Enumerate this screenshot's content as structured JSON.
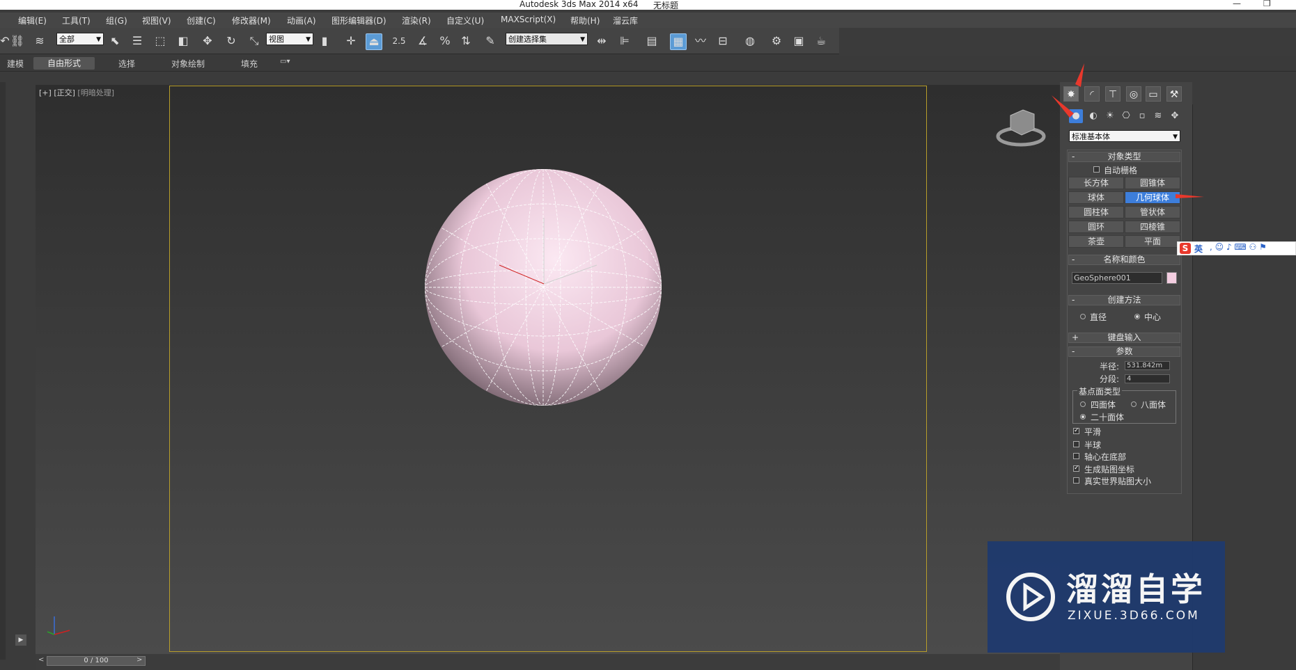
{
  "title": {
    "app": "Autodesk 3ds Max  2014 x64",
    "doc": "无标题"
  },
  "menu": [
    "编辑(E)",
    "工具(T)",
    "组(G)",
    "视图(V)",
    "创建(C)",
    "修改器(M)",
    "动画(A)",
    "图形编辑器(D)",
    "渲染(R)",
    "自定义(U)",
    "MAXScript(X)",
    "帮助(H)",
    "溜云库"
  ],
  "toolbar": {
    "filter_select": "全部",
    "coord_select": "视图",
    "snap_value": "2.5",
    "named_selection": "创建选择集"
  },
  "ribbon_tabs": [
    "建模",
    "自由形式",
    "选择",
    "对象绘制",
    "填充"
  ],
  "viewport": {
    "label_plus": "[+]",
    "label_view": "[正交]",
    "label_shading": "[明暗处理]"
  },
  "command_panel": {
    "category_select": "标准基本体",
    "object_type": {
      "title": "对象类型",
      "autogrid": "自动栅格",
      "buttons": [
        "长方体",
        "圆锥体",
        "球体",
        "几何球体",
        "圆柱体",
        "管状体",
        "圆环",
        "四棱锥",
        "茶壶",
        "平面"
      ],
      "active": "几何球体"
    },
    "name_color": {
      "title": "名称和颜色",
      "name": "GeoSphere001",
      "color": "#f3cde0"
    },
    "creation_method": {
      "title": "创建方法",
      "diameter": "直径",
      "center": "中心",
      "selected": "中心"
    },
    "keyboard_entry": {
      "title": "键盘输入"
    },
    "parameters": {
      "title": "参数",
      "radius_label": "半径:",
      "radius_value": "531.842m",
      "segments_label": "分段:",
      "segments_value": "4",
      "base_type_title": "基点面类型",
      "tetra": "四面体",
      "octa": "八面体",
      "icosa": "二十面体",
      "selected_type": "二十面体",
      "smooth": "平滑",
      "smooth_checked": true,
      "hemisphere": "半球",
      "hemisphere_checked": false,
      "base_pivot": "轴心在底部",
      "base_pivot_checked": false,
      "map_coords": "生成贴图坐标",
      "map_coords_checked": true,
      "real_world": "真实世界贴图大小",
      "real_world_checked": false
    }
  },
  "timeline": {
    "frame": "0 / 100"
  },
  "ime": {
    "lang": "英"
  },
  "watermark": {
    "cn": "溜溜自学",
    "en": "ZIXUE.3D66.COM"
  },
  "colors": {
    "accent": "#3d7edb",
    "sphere": "#f3cde0",
    "viewport_border": "#b89e2a",
    "arrow": "#e8382c"
  }
}
